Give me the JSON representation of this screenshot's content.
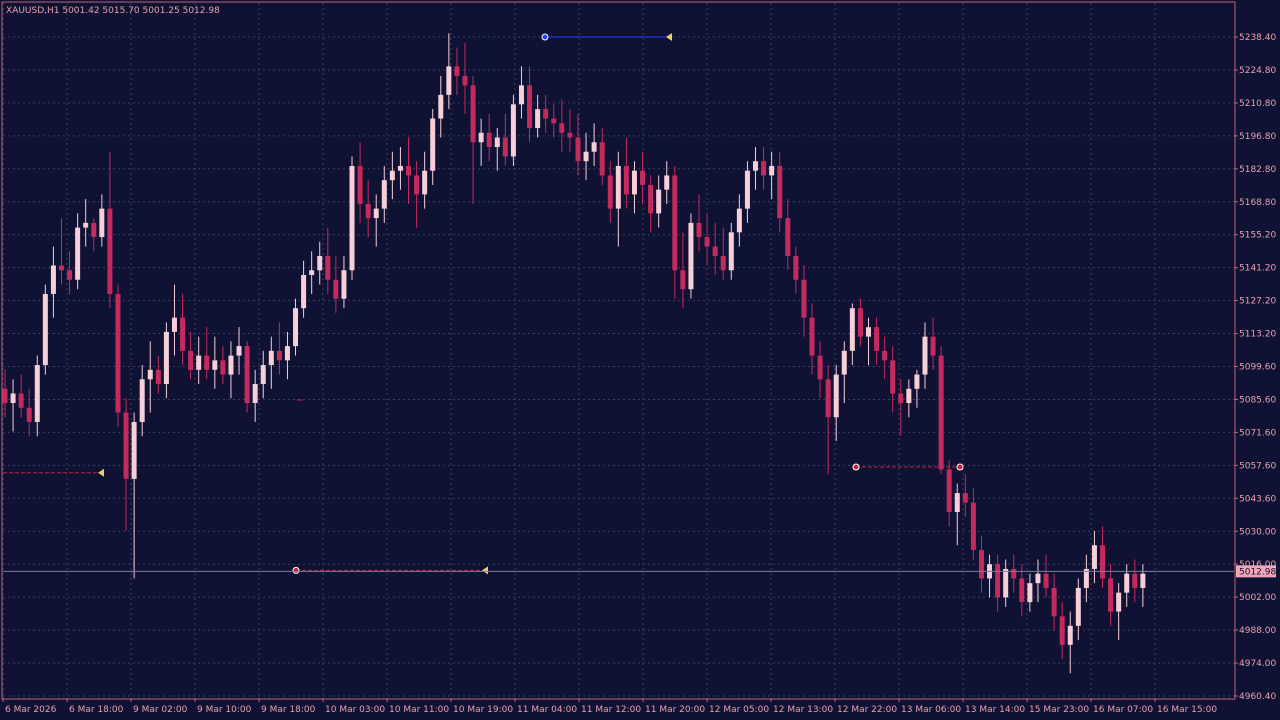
{
  "window": {
    "header_text": "XAUUSD,H1  5001.42 5015.70 5001.25 5012.98"
  },
  "colors": {
    "background": "#0f1233",
    "grid": "#3a3d63",
    "frame": "#c0627a",
    "bull": "#f6cfd9",
    "bear": "#c42a5e",
    "text": "#e8a0b0",
    "bid_label_bg": "#f2a7b8",
    "blue_line": "#2a3cff",
    "red_line": "#c8203e",
    "arrow_yellow": "#e8d070"
  },
  "price_axis": {
    "labels": [
      "5238.40",
      "5224.80",
      "5210.80",
      "5196.80",
      "5182.80",
      "5168.80",
      "5155.20",
      "5141.20",
      "5127.20",
      "5113.20",
      "5099.60",
      "5085.60",
      "5071.60",
      "5057.60",
      "5043.60",
      "5030.00",
      "5016.00",
      "5002.00",
      "4988.00",
      "4974.00",
      "4960.40"
    ],
    "current_price": "5012.98"
  },
  "time_axis": {
    "labels": [
      "6 Mar 2026",
      "6 Mar 18:00",
      "9 Mar 02:00",
      "9 Mar 10:00",
      "9 Mar 18:00",
      "10 Mar 03:00",
      "10 Mar 11:00",
      "10 Mar 19:00",
      "11 Mar 04:00",
      "11 Mar 12:00",
      "11 Mar 20:00",
      "12 Mar 05:00",
      "12 Mar 13:00",
      "12 Mar 22:00",
      "13 Mar 06:00",
      "13 Mar 14:00",
      "15 Mar 23:00",
      "16 Mar 07:00",
      "16 Mar 15:00"
    ]
  },
  "chart_data": {
    "type": "candlestick",
    "symbol": "XAUUSD",
    "timeframe": "H1",
    "ylim": [
      4960.4,
      5238.4
    ],
    "ohlc": [
      [
        5090,
        5098,
        5078,
        5084
      ],
      [
        5084,
        5094,
        5072,
        5088
      ],
      [
        5088,
        5096,
        5078,
        5082
      ],
      [
        5082,
        5090,
        5070,
        5076
      ],
      [
        5076,
        5104,
        5070,
        5100
      ],
      [
        5100,
        5134,
        5096,
        5130
      ],
      [
        5130,
        5150,
        5120,
        5142
      ],
      [
        5142,
        5162,
        5134,
        5140
      ],
      [
        5140,
        5148,
        5130,
        5136
      ],
      [
        5136,
        5164,
        5132,
        5158
      ],
      [
        5158,
        5170,
        5150,
        5160
      ],
      [
        5160,
        5162,
        5148,
        5154
      ],
      [
        5154,
        5172,
        5150,
        5166
      ],
      [
        5166,
        5190,
        5124,
        5130
      ],
      [
        5130,
        5134,
        5074,
        5080
      ],
      [
        5080,
        5086,
        5030,
        5052
      ],
      [
        5052,
        5080,
        5010,
        5076
      ],
      [
        5076,
        5100,
        5070,
        5094
      ],
      [
        5094,
        5110,
        5080,
        5098
      ],
      [
        5098,
        5104,
        5088,
        5092
      ],
      [
        5092,
        5118,
        5086,
        5114
      ],
      [
        5114,
        5134,
        5104,
        5120
      ],
      [
        5120,
        5130,
        5100,
        5106
      ],
      [
        5106,
        5114,
        5094,
        5098
      ],
      [
        5098,
        5112,
        5092,
        5104
      ],
      [
        5104,
        5116,
        5094,
        5098
      ],
      [
        5098,
        5112,
        5090,
        5102
      ],
      [
        5102,
        5108,
        5092,
        5096
      ],
      [
        5096,
        5110,
        5086,
        5104
      ],
      [
        5104,
        5116,
        5096,
        5108
      ],
      [
        5108,
        5110,
        5080,
        5084
      ],
      [
        5084,
        5098,
        5076,
        5092
      ],
      [
        5092,
        5106,
        5086,
        5100
      ],
      [
        5100,
        5112,
        5090,
        5106
      ],
      [
        5106,
        5118,
        5096,
        5102
      ],
      [
        5102,
        5114,
        5094,
        5108
      ],
      [
        5108,
        5128,
        5104,
        5124
      ],
      [
        5124,
        5144,
        5120,
        5138
      ],
      [
        5138,
        5148,
        5130,
        5140
      ],
      [
        5140,
        5152,
        5134,
        5146
      ],
      [
        5146,
        5158,
        5130,
        5136
      ],
      [
        5136,
        5146,
        5122,
        5128
      ],
      [
        5128,
        5146,
        5124,
        5140
      ],
      [
        5140,
        5188,
        5136,
        5184
      ],
      [
        5184,
        5194,
        5160,
        5168
      ],
      [
        5168,
        5178,
        5154,
        5162
      ],
      [
        5162,
        5172,
        5150,
        5166
      ],
      [
        5166,
        5184,
        5160,
        5178
      ],
      [
        5178,
        5190,
        5170,
        5182
      ],
      [
        5182,
        5192,
        5174,
        5184
      ],
      [
        5184,
        5196,
        5168,
        5180
      ],
      [
        5180,
        5186,
        5158,
        5172
      ],
      [
        5172,
        5190,
        5166,
        5182
      ],
      [
        5182,
        5208,
        5176,
        5204
      ],
      [
        5204,
        5222,
        5196,
        5214
      ],
      [
        5214,
        5240,
        5208,
        5226
      ],
      [
        5226,
        5234,
        5214,
        5222
      ],
      [
        5222,
        5236,
        5206,
        5218
      ],
      [
        5218,
        5222,
        5168,
        5194
      ],
      [
        5194,
        5204,
        5184,
        5198
      ],
      [
        5198,
        5206,
        5186,
        5192
      ],
      [
        5192,
        5200,
        5182,
        5196
      ],
      [
        5196,
        5206,
        5184,
        5188
      ],
      [
        5188,
        5214,
        5184,
        5210
      ],
      [
        5210,
        5226,
        5204,
        5218
      ],
      [
        5218,
        5226,
        5194,
        5200
      ],
      [
        5200,
        5214,
        5196,
        5208
      ],
      [
        5208,
        5214,
        5198,
        5204
      ],
      [
        5204,
        5210,
        5196,
        5202
      ],
      [
        5202,
        5212,
        5190,
        5198
      ],
      [
        5198,
        5208,
        5190,
        5196
      ],
      [
        5196,
        5206,
        5180,
        5186
      ],
      [
        5186,
        5198,
        5178,
        5190
      ],
      [
        5190,
        5202,
        5184,
        5194
      ],
      [
        5194,
        5200,
        5176,
        5180
      ],
      [
        5180,
        5186,
        5160,
        5166
      ],
      [
        5166,
        5190,
        5150,
        5184
      ],
      [
        5184,
        5196,
        5166,
        5172
      ],
      [
        5172,
        5186,
        5164,
        5182
      ],
      [
        5182,
        5190,
        5168,
        5176
      ],
      [
        5176,
        5180,
        5156,
        5164
      ],
      [
        5164,
        5180,
        5158,
        5174
      ],
      [
        5174,
        5186,
        5168,
        5180
      ],
      [
        5180,
        5184,
        5128,
        5140
      ],
      [
        5140,
        5156,
        5124,
        5132
      ],
      [
        5132,
        5164,
        5128,
        5160
      ],
      [
        5160,
        5172,
        5148,
        5154
      ],
      [
        5154,
        5164,
        5142,
        5150
      ],
      [
        5150,
        5160,
        5138,
        5146
      ],
      [
        5146,
        5158,
        5136,
        5140
      ],
      [
        5140,
        5160,
        5136,
        5156
      ],
      [
        5156,
        5172,
        5150,
        5166
      ],
      [
        5166,
        5186,
        5160,
        5182
      ],
      [
        5182,
        5192,
        5174,
        5186
      ],
      [
        5186,
        5192,
        5174,
        5180
      ],
      [
        5180,
        5190,
        5170,
        5184
      ],
      [
        5184,
        5190,
        5156,
        5162
      ],
      [
        5162,
        5170,
        5140,
        5146
      ],
      [
        5146,
        5150,
        5130,
        5136
      ],
      [
        5136,
        5142,
        5112,
        5120
      ],
      [
        5120,
        5126,
        5096,
        5104
      ],
      [
        5104,
        5110,
        5086,
        5094
      ],
      [
        5094,
        5100,
        5054,
        5078
      ],
      [
        5078,
        5100,
        5068,
        5096
      ],
      [
        5096,
        5110,
        5084,
        5106
      ],
      [
        5106,
        5126,
        5100,
        5124
      ],
      [
        5124,
        5128,
        5108,
        5112
      ],
      [
        5112,
        5120,
        5100,
        5116
      ],
      [
        5116,
        5120,
        5100,
        5106
      ],
      [
        5106,
        5112,
        5094,
        5102
      ],
      [
        5102,
        5108,
        5080,
        5088
      ],
      [
        5088,
        5094,
        5070,
        5084
      ],
      [
        5084,
        5094,
        5078,
        5090
      ],
      [
        5090,
        5098,
        5082,
        5096
      ],
      [
        5096,
        5118,
        5090,
        5112
      ],
      [
        5112,
        5120,
        5098,
        5104
      ],
      [
        5104,
        5108,
        5054,
        5056
      ],
      [
        5056,
        5060,
        5032,
        5038
      ],
      [
        5038,
        5050,
        5024,
        5046
      ],
      [
        5046,
        5054,
        5036,
        5042
      ],
      [
        5042,
        5048,
        5018,
        5022
      ],
      [
        5022,
        5028,
        5004,
        5010
      ],
      [
        5010,
        5020,
        5002,
        5016
      ],
      [
        5016,
        5020,
        4996,
        5002
      ],
      [
        5002,
        5018,
        4998,
        5014
      ],
      [
        5014,
        5020,
        5004,
        5010
      ],
      [
        5010,
        5016,
        4994,
        5000
      ],
      [
        5000,
        5012,
        4996,
        5008
      ],
      [
        5008,
        5018,
        5000,
        5012
      ],
      [
        5012,
        5020,
        5002,
        5006
      ],
      [
        5006,
        5012,
        4988,
        4994
      ],
      [
        4994,
        5000,
        4976,
        4982
      ],
      [
        4982,
        4996,
        4970,
        4990
      ],
      [
        4990,
        5010,
        4984,
        5006
      ],
      [
        5006,
        5020,
        5000,
        5014
      ],
      [
        5014,
        5030,
        5008,
        5024
      ],
      [
        5024,
        5032,
        5006,
        5010
      ],
      [
        5010,
        5016,
        4990,
        4996
      ],
      [
        4996,
        5008,
        4984,
        5004
      ],
      [
        5004,
        5016,
        4998,
        5012
      ],
      [
        5012,
        5018,
        5000,
        5006
      ],
      [
        5006,
        5016,
        4998,
        5012
      ]
    ],
    "markers": [
      {
        "type": "blue_hline",
        "price": 5238.4
      },
      {
        "type": "red_dashed",
        "price": 5054.6
      },
      {
        "type": "red_dashed",
        "price": 5013.4
      },
      {
        "type": "red_dashed",
        "price": 5057.0
      }
    ]
  }
}
